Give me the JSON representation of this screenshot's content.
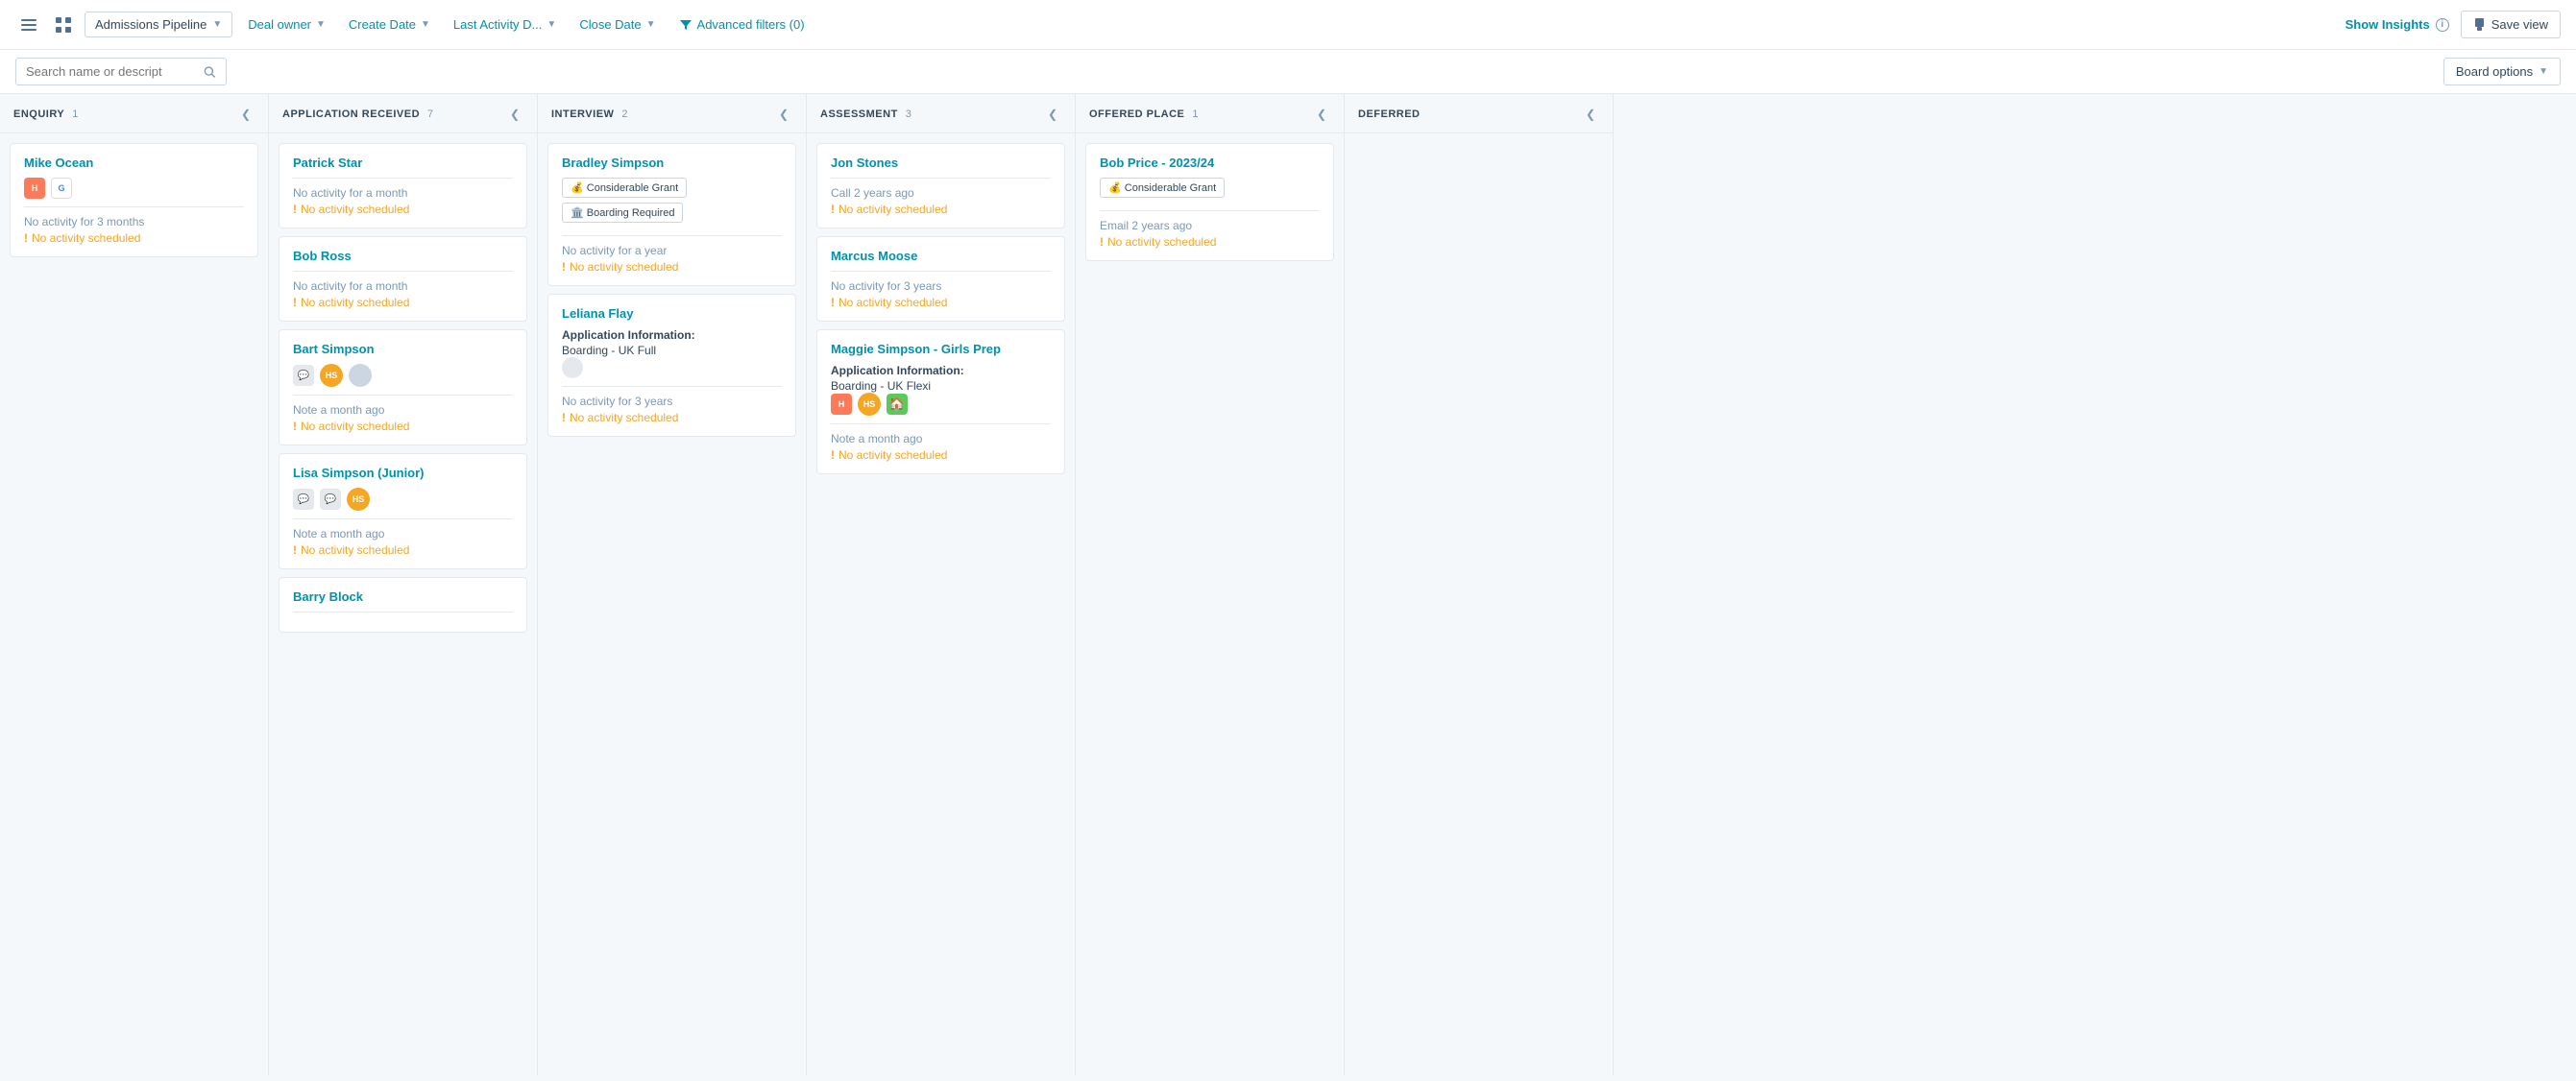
{
  "toolbar": {
    "menu_icon": "≡",
    "grid_icon": "⊞",
    "pipeline_label": "Admissions Pipeline",
    "deal_owner_label": "Deal owner",
    "create_date_label": "Create Date",
    "last_activity_label": "Last Activity D...",
    "close_date_label": "Close Date",
    "advanced_filters_label": "Advanced filters (0)",
    "show_insights_label": "Show Insights",
    "save_view_label": "Save view"
  },
  "search": {
    "placeholder": "Search name or descript",
    "board_options_label": "Board options"
  },
  "columns": [
    {
      "id": "enquiry",
      "title": "ENQUIRY",
      "count": 1,
      "cards": [
        {
          "id": "mike-ocean",
          "name": "Mike Ocean",
          "icons": [
            "hubspot-icon",
            "google-icon"
          ],
          "activity": "No activity for 3 months",
          "no_activity_scheduled": "No activity scheduled",
          "tags": [],
          "info": null
        }
      ]
    },
    {
      "id": "application-received",
      "title": "APPLICATION RECEIVED",
      "count": 7,
      "cards": [
        {
          "id": "patrick-star",
          "name": "Patrick Star",
          "icons": [],
          "activity": "No activity for a month",
          "no_activity_scheduled": "No activity scheduled",
          "tags": [],
          "info": null
        },
        {
          "id": "bob-ross",
          "name": "Bob Ross",
          "icons": [],
          "activity": "No activity for a month",
          "no_activity_scheduled": "No activity scheduled",
          "tags": [],
          "info": null
        },
        {
          "id": "bart-simpson",
          "name": "Bart Simpson",
          "icons": [
            "chat-icon",
            "hs-avatar",
            "grey-avatar"
          ],
          "activity": "Note a month ago",
          "no_activity_scheduled": "No activity scheduled",
          "tags": [],
          "info": null
        },
        {
          "id": "lisa-simpson-junior",
          "name": "Lisa Simpson (Junior)",
          "icons": [
            "chat-icon",
            "chat-icon2",
            "hs-avatar"
          ],
          "activity": "Note a month ago",
          "no_activity_scheduled": "No activity scheduled",
          "tags": [],
          "info": null
        },
        {
          "id": "barry-block",
          "name": "Barry Block",
          "icons": [],
          "activity": "",
          "no_activity_scheduled": "",
          "tags": [],
          "info": null
        }
      ]
    },
    {
      "id": "interview",
      "title": "INTERVIEW",
      "count": 2,
      "cards": [
        {
          "id": "bradley-simpson",
          "name": "Bradley Simpson",
          "icons": [],
          "activity": "No activity for a year",
          "no_activity_scheduled": "No activity scheduled",
          "tags": [
            {
              "emoji": "💰",
              "label": "Considerable Grant"
            },
            {
              "emoji": "🏛️",
              "label": "Boarding Required"
            }
          ],
          "info": null
        },
        {
          "id": "leliana-flay",
          "name": "Leliana Flay",
          "icons": [
            "grey-circle"
          ],
          "activity": "No activity for 3 years",
          "no_activity_scheduled": "No activity scheduled",
          "tags": [],
          "info": {
            "label": "Application Information:",
            "value": "Boarding - UK Full"
          }
        }
      ]
    },
    {
      "id": "assessment",
      "title": "ASSESSMENT",
      "count": 3,
      "cards": [
        {
          "id": "jon-stones",
          "name": "Jon Stones",
          "icons": [],
          "activity": "Call 2 years ago",
          "no_activity_scheduled": "No activity scheduled",
          "tags": [],
          "info": null
        },
        {
          "id": "marcus-moose",
          "name": "Marcus Moose",
          "icons": [],
          "activity": "No activity for 3 years",
          "no_activity_scheduled": "No activity scheduled",
          "tags": [],
          "info": null
        },
        {
          "id": "maggie-simpson-girls-prep",
          "name": "Maggie Simpson - Girls Prep",
          "icons": [
            "hubspot-icon",
            "hs-avatar",
            "house-icon"
          ],
          "activity": "Note a month ago",
          "no_activity_scheduled": "No activity scheduled",
          "tags": [],
          "info": {
            "label": "Application Information:",
            "value": "Boarding - UK Flexi"
          }
        }
      ]
    },
    {
      "id": "offered-place",
      "title": "OFFERED PLACE",
      "count": 1,
      "cards": [
        {
          "id": "bob-price-2023-24",
          "name": "Bob Price - 2023/24",
          "icons": [],
          "activity": "Email 2 years ago",
          "no_activity_scheduled": "No activity scheduled",
          "tags": [
            {
              "emoji": "💰",
              "label": "Considerable Grant"
            }
          ],
          "info": null
        }
      ]
    },
    {
      "id": "deferred",
      "title": "DEFERRED",
      "count": null,
      "cards": []
    }
  ]
}
